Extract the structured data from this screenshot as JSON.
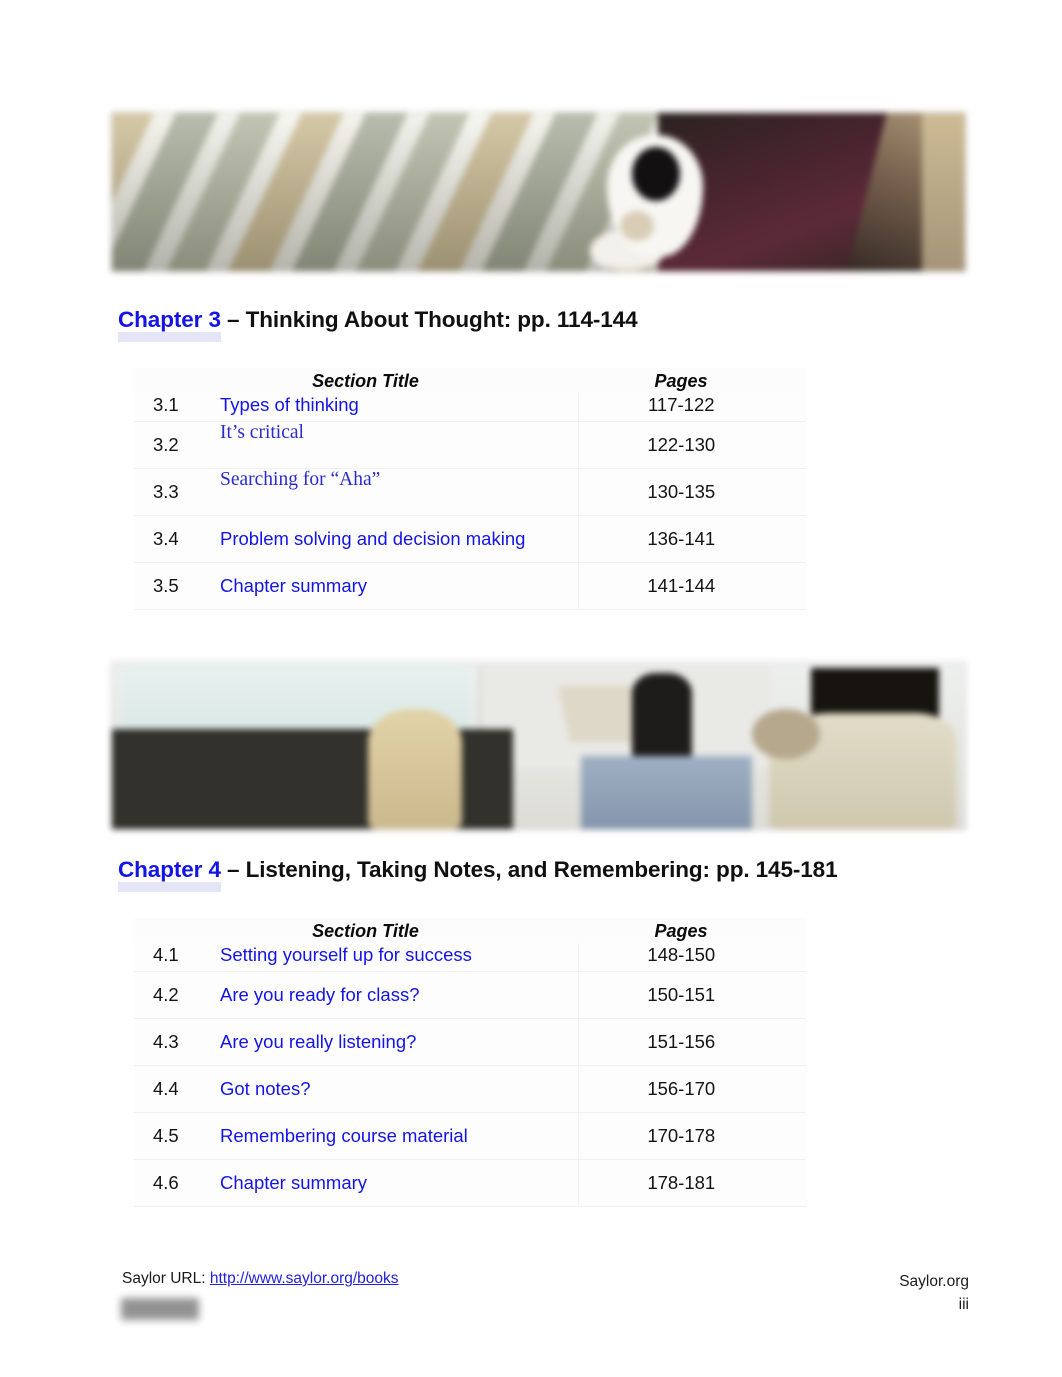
{
  "document": {
    "page_number": "iii"
  },
  "banners": [
    {
      "name": "chapter-3-banner",
      "alt": "blurred diagonal striped photo banner"
    },
    {
      "name": "chapter-4-banner",
      "alt": "blurred classroom lecture photo banner"
    }
  ],
  "chapters": [
    {
      "link_label": "Chapter 3",
      "heading_rest": " – Thinking About Thought: pp. 114-144",
      "table": {
        "headers": {
          "section_title": "Section Title",
          "pages": "Pages"
        },
        "rows": [
          {
            "section": "3.1",
            "title": "Types of thinking",
            "pages": "117-122",
            "font": "sans"
          },
          {
            "section": "3.2",
            "title": "It’s critical",
            "pages": "122-130",
            "font": "serif"
          },
          {
            "section": "3.3",
            "title": "Searching for “Aha”",
            "pages": "130-135",
            "font": "serif"
          },
          {
            "section": "3.4",
            "title": "Problem solving and decision making",
            "pages": "136-141",
            "font": "sans"
          },
          {
            "section": "3.5",
            "title": "Chapter summary",
            "pages": "141-144",
            "font": "sans"
          }
        ]
      }
    },
    {
      "link_label": "Chapter 4",
      "heading_rest": " – Listening, Taking Notes, and Remembering: pp. 145-181",
      "table": {
        "headers": {
          "section_title": "Section Title",
          "pages": "Pages"
        },
        "rows": [
          {
            "section": "4.1",
            "title": "Setting yourself up for success",
            "pages": "148-150",
            "font": "sans"
          },
          {
            "section": "4.2",
            "title": "Are you ready for class?",
            "pages": "150-151",
            "font": "sans"
          },
          {
            "section": "4.3",
            "title": "Are you really listening?",
            "pages": "151-156",
            "font": "sans"
          },
          {
            "section": "4.4",
            "title": "Got notes?",
            "pages": "156-170",
            "font": "sans"
          },
          {
            "section": "4.5",
            "title": "Remembering course material",
            "pages": "170-178",
            "font": "sans"
          },
          {
            "section": "4.6",
            "title": "Chapter summary",
            "pages": "178-181",
            "font": "sans"
          }
        ]
      }
    }
  ],
  "footer": {
    "url_prefix": "Saylor URL: ",
    "url": "http://www.saylor.org/books",
    "site": "Saylor.org",
    "page": "iii"
  },
  "colors": {
    "link_blue": "#1414e6",
    "heading_black": "#101010",
    "highlight": "#ced1f0",
    "redaction_gray": "#8d8d8d"
  }
}
